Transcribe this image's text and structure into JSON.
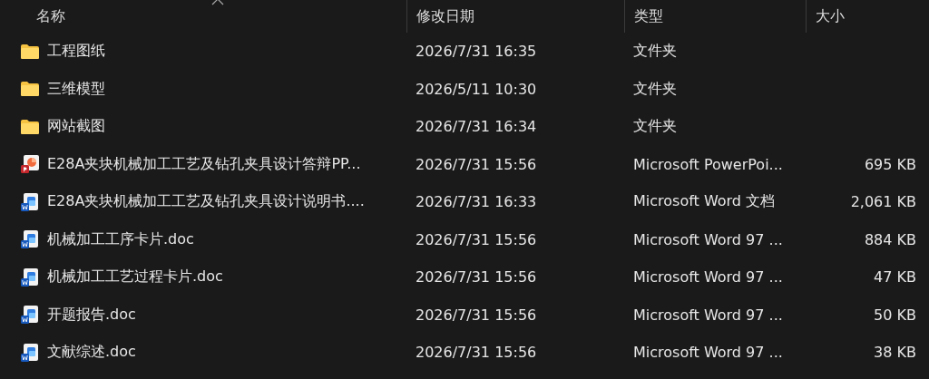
{
  "columns": [
    "名称",
    "修改日期",
    "类型",
    "大小"
  ],
  "rows": [
    {
      "kind": "folder",
      "name": "工程图纸",
      "date": "2026/7/31 16:35",
      "type": "文件夹"
    },
    {
      "kind": "folder",
      "name": "三维模型",
      "date": "2026/5/11 10:30",
      "type": "文件夹"
    },
    {
      "kind": "folder",
      "name": "网站截图",
      "date": "2026/7/31 16:34",
      "type": "文件夹"
    },
    {
      "kind": "powerpoint",
      "name": "E28A夹块机械加工工艺及钻孔夹具设计答辩PP...",
      "date": "2026/7/31 15:56",
      "type": "Microsoft PowerPoi...",
      "size": "695 KB"
    },
    {
      "kind": "word",
      "name": "E28A夹块机械加工工艺及钻孔夹具设计说明书....",
      "date": "2026/7/31 16:33",
      "type": "Microsoft Word 文档",
      "size": "2,061 KB"
    },
    {
      "kind": "word",
      "name": "机械加工工序卡片.doc",
      "date": "2026/7/31 15:56",
      "type": "Microsoft Word 97 ...",
      "size": "884 KB"
    },
    {
      "kind": "word",
      "name": "机械加工工艺过程卡片.doc",
      "date": "2026/7/31 15:56",
      "type": "Microsoft Word 97 ...",
      "size": "47 KB"
    },
    {
      "kind": "word",
      "name": "开题报告.doc",
      "date": "2026/7/31 15:56",
      "type": "Microsoft Word 97 ...",
      "size": "50 KB"
    },
    {
      "kind": "word",
      "name": "文献综述.doc",
      "date": "2026/7/31 15:56",
      "type": "Microsoft Word 97 ...",
      "size": "38 KB"
    }
  ]
}
